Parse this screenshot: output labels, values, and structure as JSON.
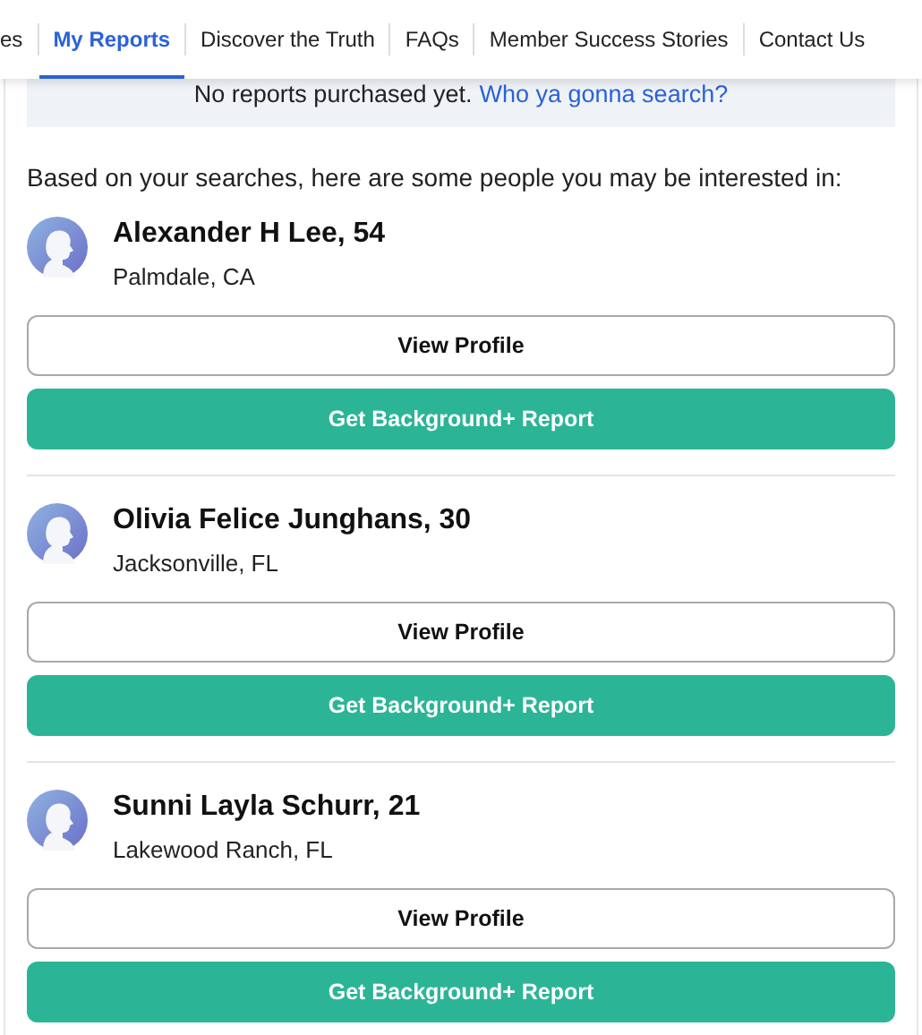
{
  "nav": {
    "tabs": [
      {
        "label": "es",
        "selected": false
      },
      {
        "label": "My Reports",
        "selected": true
      },
      {
        "label": "Discover the Truth",
        "selected": false
      },
      {
        "label": "FAQs",
        "selected": false
      },
      {
        "label": "Member Success Stories",
        "selected": false
      },
      {
        "label": "Contact Us",
        "selected": false
      }
    ]
  },
  "notice": {
    "text": "No reports purchased yet.",
    "link": "Who ya gonna search?"
  },
  "intro": "Based on your searches, here are some people you may be interested in:",
  "people": [
    {
      "name": "Alexander H Lee, 54",
      "location": "Palmdale, CA",
      "profile_button": "View Profile",
      "report_button": "Get Background+ Report"
    },
    {
      "name": "Olivia Felice Junghans, 30",
      "location": "Jacksonville, FL",
      "profile_button": "View Profile",
      "report_button": "Get Background+ Report"
    },
    {
      "name": "Sunni Layla Schurr, 21",
      "location": "Lakewood Ranch, FL",
      "profile_button": "View Profile",
      "report_button": "Get Background+ Report"
    }
  ]
}
